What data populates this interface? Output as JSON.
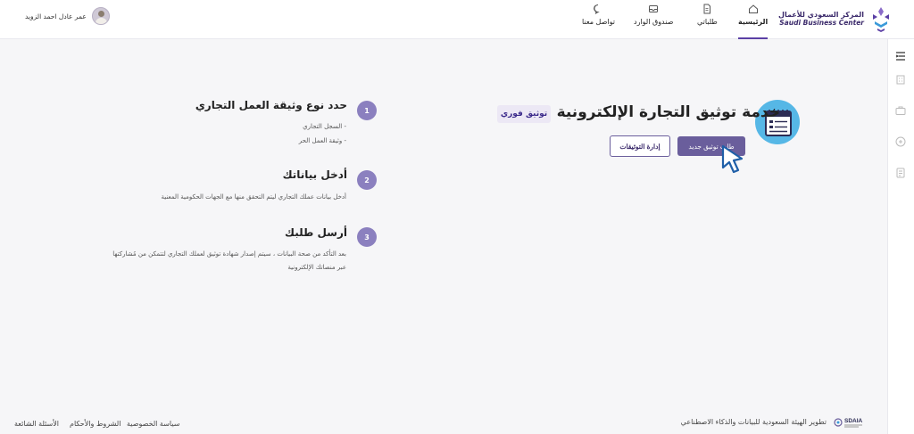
{
  "header": {
    "logo": {
      "ar": "المركز السعودي للأعمال",
      "en": "Saudi Business Center"
    },
    "nav": [
      {
        "label": "الرئيسية",
        "icon": "home-icon",
        "active": true
      },
      {
        "label": "طلباتي",
        "icon": "document-icon",
        "active": false
      },
      {
        "label": "صندوق الوارد",
        "icon": "inbox-icon",
        "active": false
      },
      {
        "label": "تواصل معنا",
        "icon": "chat-icon",
        "active": false
      }
    ],
    "user_name": "عمر عادل احمد الزويد"
  },
  "hero": {
    "title": "خدمة توثيق التجارة الإلكترونية",
    "badge": "توثيق فوري",
    "primary_button": "طلب توثيق جديد",
    "secondary_button": "إدارة التوثيقات"
  },
  "steps": [
    {
      "number": "1",
      "title": "حدد نوع وثيقة العمل التجاري",
      "lines": [
        "- السجل التجاري",
        "- وثيقة العمل الحر"
      ]
    },
    {
      "number": "2",
      "title": "أدخل بياناتك",
      "lines": [
        "أدخل بيانات عملك التجاري ليتم التحقق منها مع الجهات الحكومية المعنية"
      ]
    },
    {
      "number": "3",
      "title": "أرسل طلبك",
      "lines": [
        "بعد التأكد من صحة البيانات ، سيتم إصدار شهادة توثيق لعملك التجاري لتتمكن من مُشاركتها",
        "عبر منصاتك الإلكترونية"
      ]
    }
  ],
  "footer": {
    "links": [
      "الأسئلة الشائعة",
      "الشروط والأحكام",
      "سياسة الخصوصية"
    ],
    "credit": "تطوير الهيئة السعودية للبيانات والذكاء الاصطناعي",
    "sdaia_logo": "SDAIA"
  },
  "colors": {
    "brand": "#5b3fa5",
    "primary_button": "#6a5e9c",
    "step_circle": "#8b80bf",
    "hero_icon_bg": "#56b7e6"
  }
}
